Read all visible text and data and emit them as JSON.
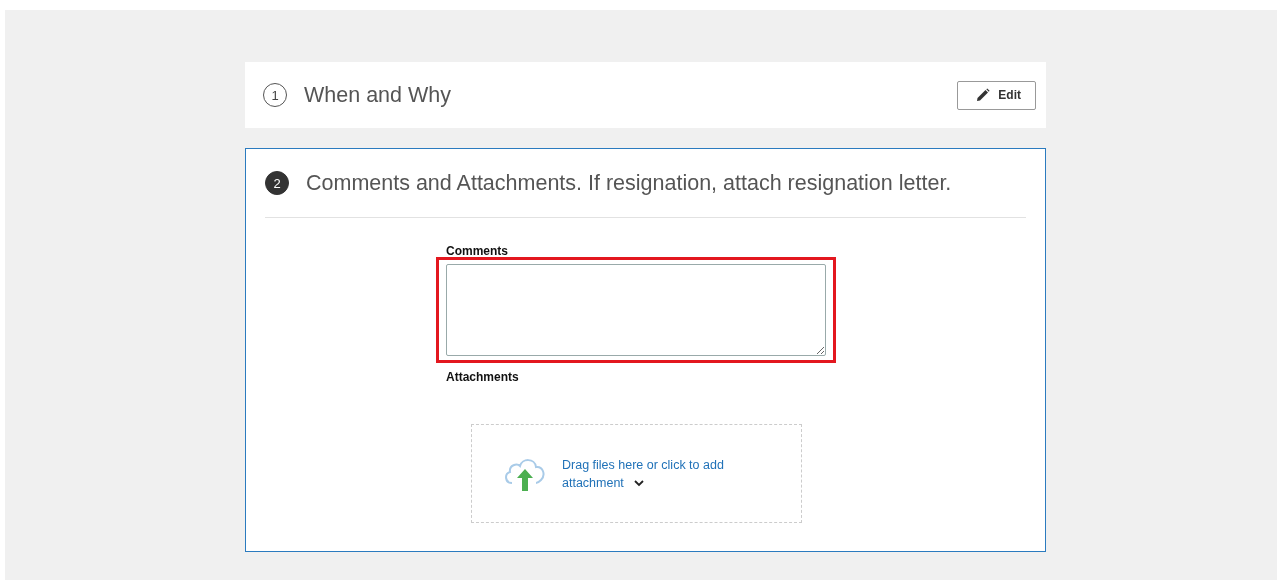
{
  "steps": [
    {
      "number": "1",
      "title": "When and Why",
      "active": false,
      "edit_button": "Edit"
    },
    {
      "number": "2",
      "title": "Comments and Attachments. If resignation, attach resignation letter.",
      "active": true
    }
  ],
  "comments": {
    "label": "Comments",
    "highlighted": true
  },
  "attachments": {
    "label": "Attachments",
    "drop_text": "Drag files here or click to add attachment"
  }
}
